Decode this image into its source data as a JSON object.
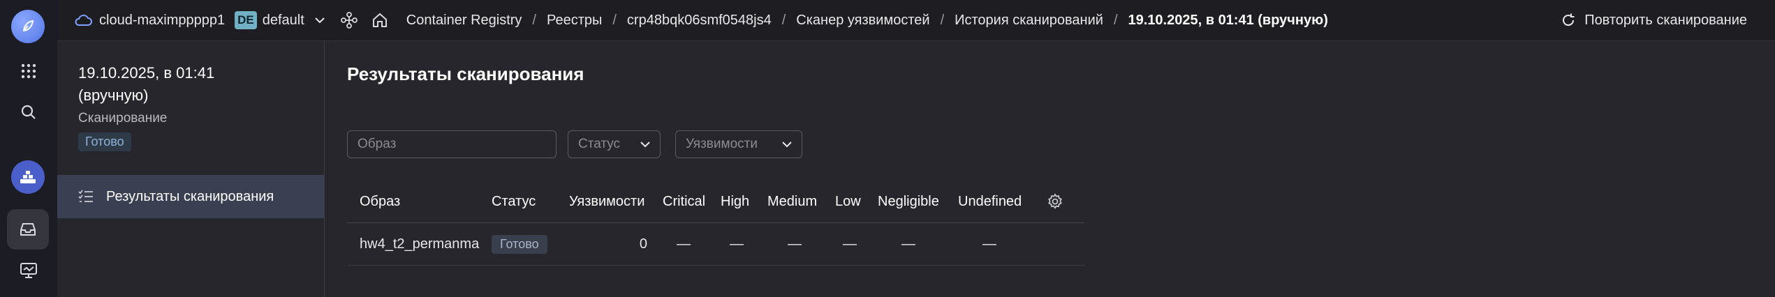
{
  "breadcrumbs": {
    "cloud": "cloud-maximppppp1",
    "folder_badge": "DE",
    "folder": "default",
    "items": [
      "Container Registry",
      "Реестры",
      "crp48bqk06smf0548js4",
      "Сканер уязвимостей",
      "История сканирований",
      "19.10.2025, в 01:41 (вручную)"
    ],
    "separator": "/"
  },
  "retry_label": "Повторить сканирование",
  "sidebar": {
    "title": "19.10.2025, в 01:41 (вручную)",
    "subtitle": "Сканирование",
    "status": "Готово",
    "nav_item": "Результаты сканирования"
  },
  "main": {
    "title": "Результаты сканирования",
    "filters": {
      "image_placeholder": "Образ",
      "status_label": "Статус",
      "vuln_label": "Уязвимости"
    }
  },
  "table": {
    "columns": [
      "Образ",
      "Статус",
      "Уязвимости",
      "Critical",
      "High",
      "Medium",
      "Low",
      "Negligible",
      "Undefined"
    ],
    "rows": [
      {
        "image": "hw4_t2_permanma",
        "status": "Готово",
        "vulns": "0",
        "critical": "—",
        "high": "—",
        "medium": "—",
        "low": "—",
        "negligible": "—",
        "undefined": "—"
      }
    ]
  },
  "colors": {
    "accent": "#5476e6",
    "background": "#26262c",
    "topbar": "#1e1e22",
    "rail": "#1c1d24",
    "nav_active": "#3a3f52"
  },
  "icons": [
    "logo-icon",
    "apps-grid-icon",
    "search-icon",
    "deploy-icon",
    "inbox-icon",
    "monitor-icon",
    "cloud-icon",
    "chevron-down-icon",
    "network-icon",
    "home-icon",
    "refresh-icon",
    "list-check-icon",
    "gear-icon"
  ]
}
